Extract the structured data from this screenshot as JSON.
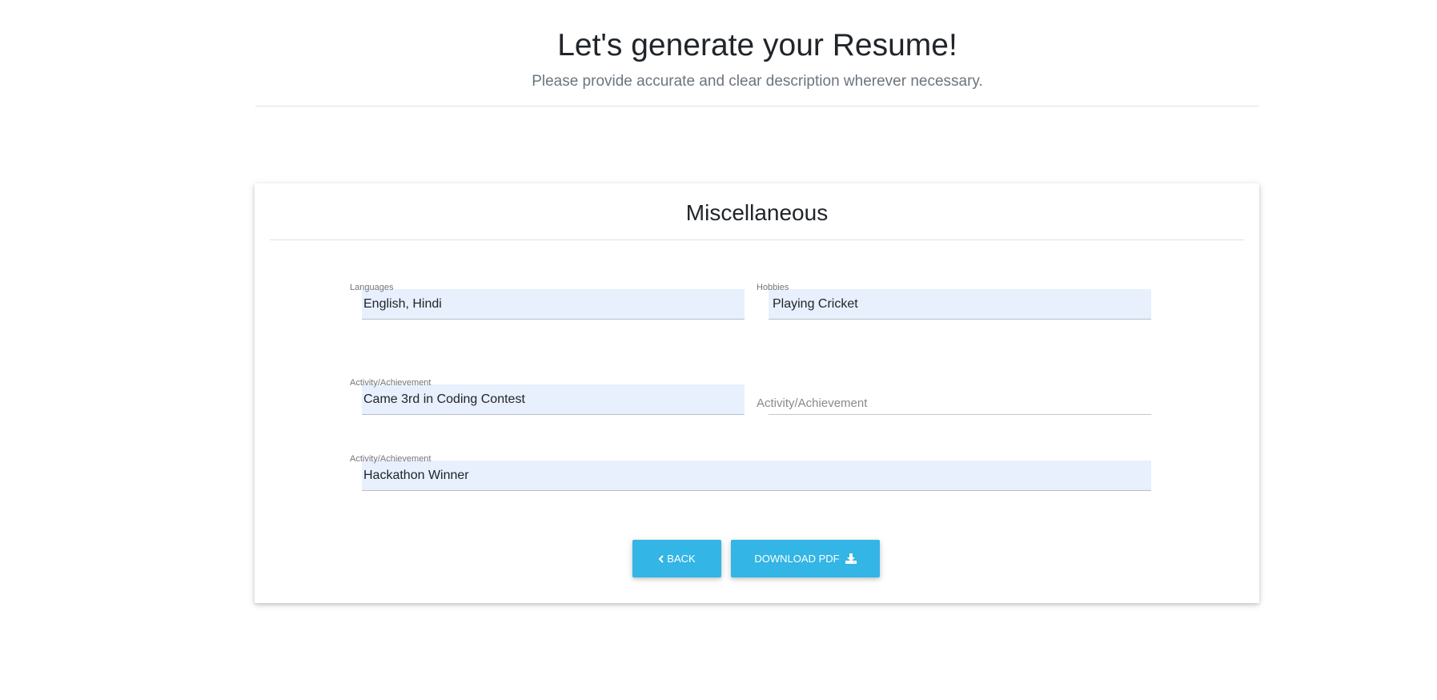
{
  "header": {
    "title": "Let's generate your Resume!",
    "subtitle": "Please provide accurate and clear description wherever necessary."
  },
  "card": {
    "title": "Miscellaneous",
    "fields": {
      "languages": {
        "label": "Languages",
        "value": "English, Hindi"
      },
      "hobbies": {
        "label": "Hobbies",
        "value": "Playing Cricket"
      },
      "activity1": {
        "label": "Activity/Achievement",
        "value": "Came 3rd in Coding Contest"
      },
      "activity2": {
        "label": "Activity/Achievement",
        "value": ""
      },
      "activity3": {
        "label": "Activity/Achievement",
        "value": "Hackathon Winner"
      }
    },
    "buttons": {
      "back": {
        "label": "Back",
        "icon": "chevron-left-icon"
      },
      "download": {
        "label": "Download PDF",
        "icon": "download-icon"
      }
    }
  },
  "colors": {
    "accent": "#33b5e5",
    "autofill": "#e8f0fe"
  }
}
